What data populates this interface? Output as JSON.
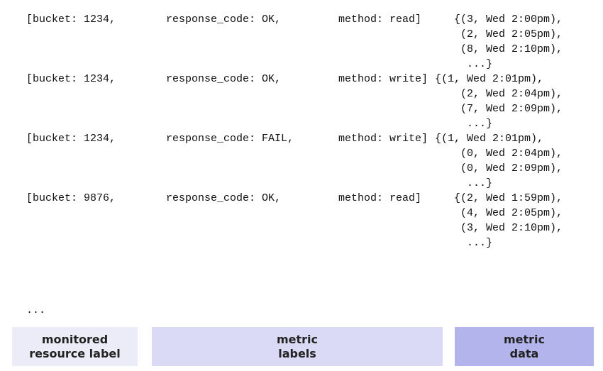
{
  "series": [
    {
      "bucket": "[bucket: 1234,",
      "response_code": "response_code: OK,",
      "method": "method: read]",
      "points": [
        "{(3, Wed 2:00pm),",
        "(2, Wed 2:05pm),",
        "(8, Wed 2:10pm),",
        "...}"
      ]
    },
    {
      "bucket": "[bucket: 1234,",
      "response_code": "response_code: OK,",
      "method": "method: write]",
      "points": [
        "{(1, Wed 2:01pm),",
        "(2, Wed 2:04pm),",
        "(7, Wed 2:09pm),",
        "...}"
      ]
    },
    {
      "bucket": "[bucket: 1234,",
      "response_code": "response_code: FAIL,",
      "method": "method: write]",
      "points": [
        "{(1, Wed 2:01pm),",
        "(0, Wed 2:04pm),",
        "(0, Wed 2:09pm),",
        "...}"
      ]
    },
    {
      "bucket": "[bucket: 9876,",
      "response_code": "response_code: OK,",
      "method": "method: read]",
      "points": [
        "{(2, Wed 1:59pm),",
        "(4, Wed 2:05pm),",
        "(3, Wed 2:10pm),",
        "...}"
      ]
    }
  ],
  "ellipsis": "...",
  "legend": {
    "resource": {
      "line1": "monitored",
      "line2": "resource label",
      "color": "#ececf8"
    },
    "metric_labels": {
      "line1": "metric",
      "line2": "labels",
      "color": "#dadaf6"
    },
    "metric_data": {
      "line1": "metric",
      "line2": "data",
      "color": "#b4b4ec"
    }
  }
}
